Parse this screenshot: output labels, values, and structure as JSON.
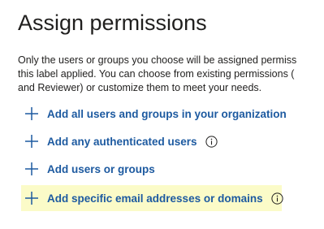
{
  "header": {
    "title": "Assign permissions"
  },
  "description": {
    "line1": "Only the users or groups you choose will be assigned permiss",
    "line2": "this label applied. You can choose from existing permissions (",
    "line3": "and Reviewer) or customize them to meet your needs."
  },
  "actions": [
    {
      "label": "Add all users and groups in your organization",
      "icon": "plus-icon",
      "has_info": false
    },
    {
      "label": "Add any authenticated users",
      "icon": "plus-icon",
      "has_info": true
    },
    {
      "label": "Add users or groups",
      "icon": "plus-icon",
      "has_info": false
    },
    {
      "label": "Add specific email addresses or domains",
      "icon": "plus-icon",
      "has_info": true,
      "highlighted": true
    }
  ],
  "colors": {
    "link": "#1d5aa0",
    "highlight": "#fbfbc8",
    "text": "#201f1e"
  }
}
